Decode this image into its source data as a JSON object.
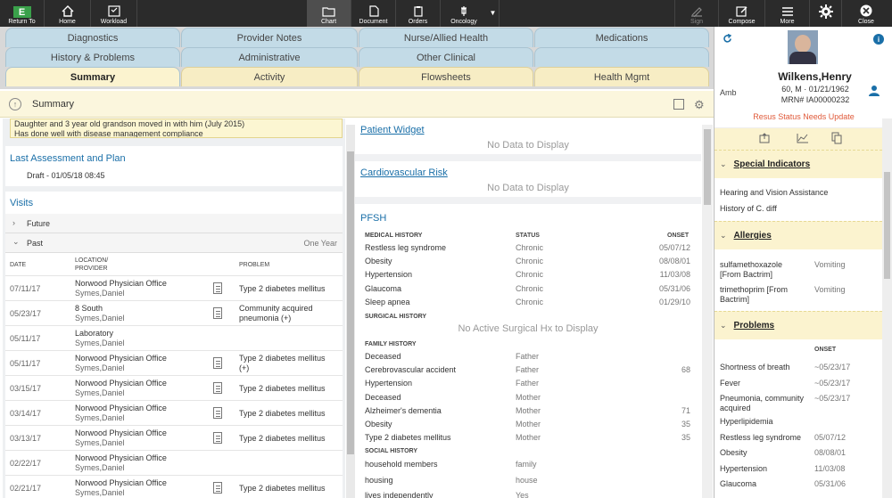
{
  "toolbar": {
    "return_to": "Return To",
    "home": "Home",
    "workload": "Workload",
    "chart": "Chart",
    "document": "Document",
    "orders": "Orders",
    "oncology": "Oncology",
    "sign": "Sign",
    "compose": "Compose",
    "more": "More",
    "close": "Close"
  },
  "tabs": {
    "row1": [
      "Diagnostics",
      "Provider Notes",
      "Nurse/Allied Health",
      "Medications"
    ],
    "row2": [
      "History & Problems",
      "Administrative",
      "Other Clinical",
      ""
    ],
    "row3": [
      "Summary",
      "Activity",
      "Flowsheets",
      "Health Mgmt"
    ]
  },
  "subheader": {
    "title": "Summary"
  },
  "left": {
    "note_line1": "Daughter and 3 year old grandson moved in with him (July 2015)",
    "note_line2": "Has done well with disease management compliance",
    "last_assessment": {
      "title": "Last Assessment and Plan",
      "value": "Draft - 01/05/18 08:45"
    },
    "visits": {
      "title": "Visits",
      "future": "Future",
      "past": "Past",
      "range": "One Year",
      "col_date": "DATE",
      "col_location": "LOCATION/",
      "col_provider": "PROVIDER",
      "col_problem": "PROBLEM",
      "rows": [
        {
          "date": "07/11/17",
          "loc": "Norwood Physician Office",
          "prov": "Symes,Daniel",
          "doc": true,
          "prob": "Type 2 diabetes mellitus",
          "prob2": ""
        },
        {
          "date": "05/23/17",
          "loc": "8 South",
          "prov": "Symes,Daniel",
          "doc": true,
          "prob": "Community acquired",
          "prob2": "pneumonia (+)"
        },
        {
          "date": "05/11/17",
          "loc": "Laboratory",
          "prov": "Symes,Daniel",
          "doc": false,
          "prob": "",
          "prob2": ""
        },
        {
          "date": "05/11/17",
          "loc": "Norwood Physician Office",
          "prov": "Symes,Daniel",
          "doc": true,
          "prob": "Type 2 diabetes mellitus",
          "prob2": "(+)"
        },
        {
          "date": "03/15/17",
          "loc": "Norwood Physician Office",
          "prov": "Symes,Daniel",
          "doc": true,
          "prob": "Type 2 diabetes mellitus",
          "prob2": ""
        },
        {
          "date": "03/14/17",
          "loc": "Norwood Physician Office",
          "prov": "Symes,Daniel",
          "doc": true,
          "prob": "Type 2 diabetes mellitus",
          "prob2": ""
        },
        {
          "date": "03/13/17",
          "loc": "Norwood Physician Office",
          "prov": "Symes,Daniel",
          "doc": true,
          "prob": "Type 2 diabetes mellitus",
          "prob2": ""
        },
        {
          "date": "02/22/17",
          "loc": "Norwood Physician Office",
          "prov": "Symes,Daniel",
          "doc": false,
          "prob": "",
          "prob2": ""
        },
        {
          "date": "02/21/17",
          "loc": "Norwood Physician Office",
          "prov": "Symes,Daniel",
          "doc": true,
          "prob": "Type 2 diabetes mellitus",
          "prob2": ""
        }
      ]
    }
  },
  "mid": {
    "patient_widget": {
      "title": "Patient Widget",
      "empty": "No Data to Display"
    },
    "cardio": {
      "title": "Cardiovascular Risk",
      "empty": "No Data to Display"
    },
    "pfsh": {
      "title": "PFSH",
      "medical_history_label": "MEDICAL HISTORY",
      "status_label": "STATUS",
      "onset_label": "ONSET",
      "medical": [
        {
          "name": "Restless leg syndrome",
          "status": "Chronic",
          "onset": "05/07/12"
        },
        {
          "name": "Obesity",
          "status": "Chronic",
          "onset": "08/08/01"
        },
        {
          "name": "Hypertension",
          "status": "Chronic",
          "onset": "11/03/08"
        },
        {
          "name": "Glaucoma",
          "status": "Chronic",
          "onset": "05/31/06"
        },
        {
          "name": "Sleep apnea",
          "status": "Chronic",
          "onset": "01/29/10"
        }
      ],
      "surgical_label": "SURGICAL HISTORY",
      "surgical_empty": "No Active Surgical Hx to Display",
      "family_label": "FAMILY HISTORY",
      "family": [
        {
          "name": "Deceased",
          "rel": "Father",
          "age": ""
        },
        {
          "name": "Cerebrovascular accident",
          "rel": "Father",
          "age": "68"
        },
        {
          "name": "Hypertension",
          "rel": "Father",
          "age": ""
        },
        {
          "name": "Deceased",
          "rel": "Mother",
          "age": ""
        },
        {
          "name": "Alzheimer's dementia",
          "rel": "Mother",
          "age": "71"
        },
        {
          "name": "Obesity",
          "rel": "Mother",
          "age": "35"
        },
        {
          "name": "Type 2 diabetes mellitus",
          "rel": "Mother",
          "age": "35"
        }
      ],
      "social_label": "SOCIAL HISTORY",
      "social": [
        {
          "name": "household members",
          "val": "family"
        },
        {
          "name": "housing",
          "val": "house"
        },
        {
          "name": "lives independently",
          "val": "Yes"
        }
      ]
    }
  },
  "patient": {
    "name": "Wilkens,Henry",
    "type": "Amb",
    "age_sex_dob": "60, M · 01/21/1962",
    "mrn_label": "MRN#",
    "mrn": "IA00000232",
    "resus": "Resus Status Needs Update",
    "special_indicators": {
      "title": "Special Indicators",
      "items": [
        "Hearing and Vision Assistance",
        "History of C. diff"
      ]
    },
    "allergies": {
      "title": "Allergies",
      "items": [
        {
          "name": "sulfamethoxazole",
          "name2": "[From Bactrim]",
          "reaction": "Vomiting"
        },
        {
          "name": "trimethoprim [From",
          "name2": "Bactrim]",
          "reaction": "Vomiting"
        }
      ]
    },
    "problems": {
      "title": "Problems",
      "onset_label": "ONSET",
      "items": [
        {
          "name": "Shortness of breath",
          "name2": "",
          "onset": "~05/23/17"
        },
        {
          "name": "Fever",
          "name2": "",
          "onset": "~05/23/17"
        },
        {
          "name": "Pneumonia, community",
          "name2": "acquired",
          "onset": "~05/23/17"
        },
        {
          "name": "Hyperlipidemia",
          "name2": "",
          "onset": ""
        },
        {
          "name": "Restless leg syndrome",
          "name2": "",
          "onset": "05/07/12"
        },
        {
          "name": "Obesity",
          "name2": "",
          "onset": "08/08/01"
        },
        {
          "name": "Hypertension",
          "name2": "",
          "onset": "11/03/08"
        },
        {
          "name": "Glaucoma",
          "name2": "",
          "onset": "05/31/06"
        }
      ]
    }
  },
  "colors": {
    "toolbar": "#2b2b2b",
    "link": "#1a6fa8",
    "resus": "#e05a3a",
    "tab_blue": "#c5dbe6",
    "tab_yellow": "#f7edc4",
    "brand_green": "#3aa14a"
  }
}
